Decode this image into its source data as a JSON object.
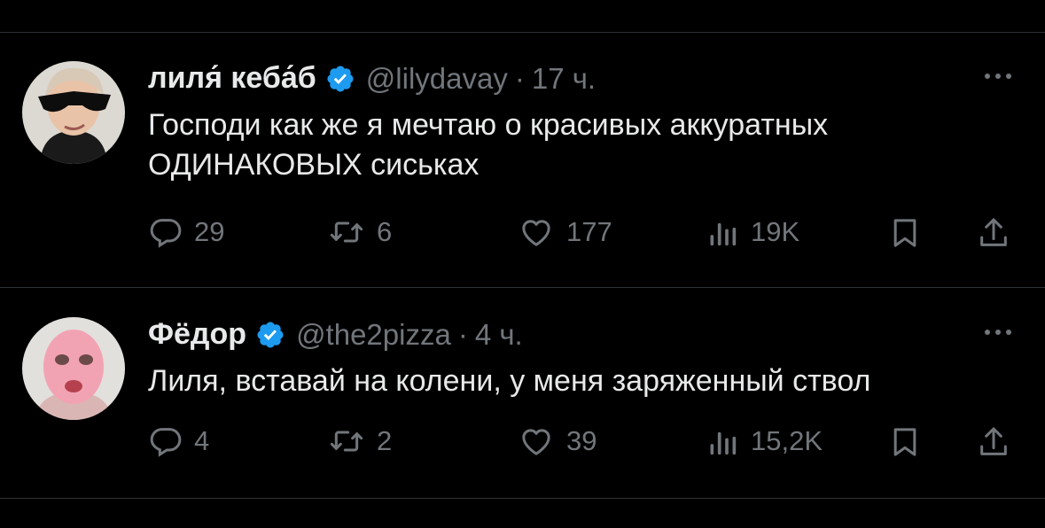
{
  "tweets": [
    {
      "author_name": "лиля́ кеба́б",
      "handle": "@lilydavay",
      "separator": "·",
      "time": "17 ч.",
      "text_line1": "Господи как же я мечтаю о красивых аккуратных",
      "text_line2": "ОДИНАКОВЫХ сиськах",
      "replies": "29",
      "reposts": "6",
      "likes": "177",
      "views": "19K"
    },
    {
      "author_name": "Фёдор",
      "handle": "@the2pizza",
      "separator": "·",
      "time": "4 ч.",
      "text_line1": "Лиля, вставай на колени, у меня заряженный ствол",
      "replies": "4",
      "reposts": "2",
      "likes": "39",
      "views": "15,2K"
    }
  ],
  "icons": {
    "verified": "verified-badge-icon",
    "more": "more-icon",
    "reply": "reply-icon",
    "repost": "repost-icon",
    "like": "heart-icon",
    "views": "views-icon",
    "bookmark": "bookmark-icon",
    "share": "share-icon"
  },
  "colors": {
    "background": "#000000",
    "text": "#e7e9ea",
    "secondary": "#71767b",
    "verified": "#1d9bf0",
    "divider": "#2f3336"
  }
}
